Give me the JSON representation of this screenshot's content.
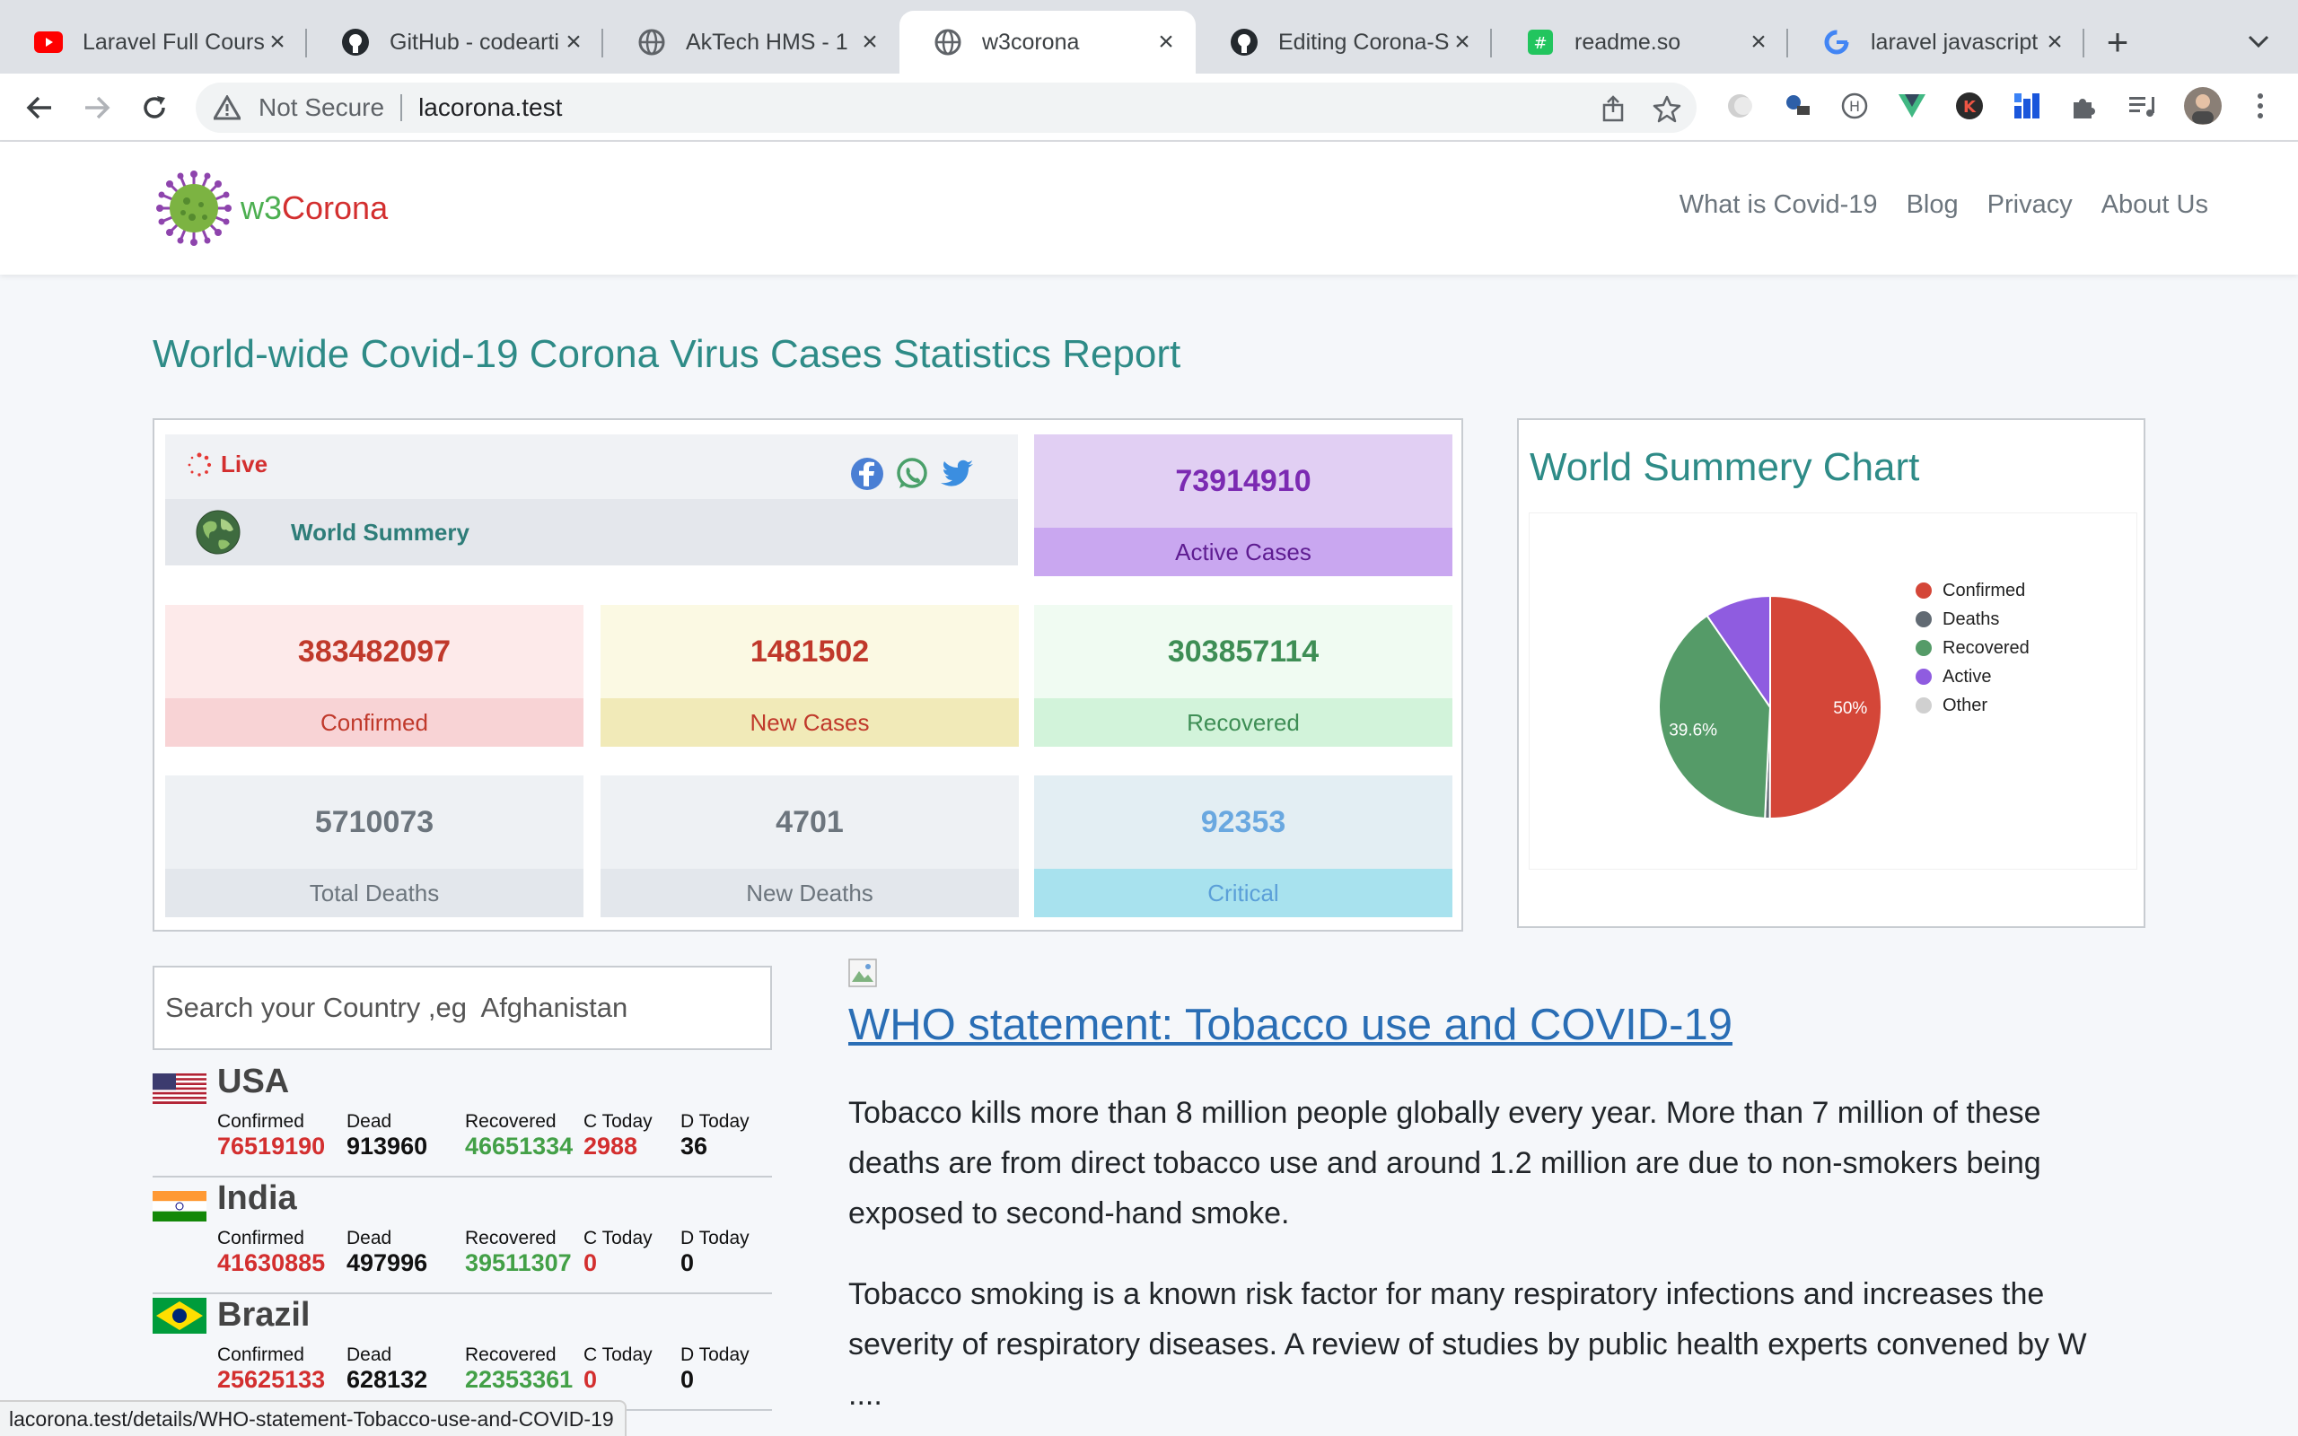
{
  "browser": {
    "tabs": [
      {
        "title": "Laravel Full Cours",
        "icon": "youtube-icon"
      },
      {
        "title": "GitHub - codearti",
        "icon": "github-icon"
      },
      {
        "title": "AkTech HMS - 1",
        "icon": "globe-icon"
      },
      {
        "title": "w3corona",
        "icon": "globe-icon",
        "active": true
      },
      {
        "title": "Editing Corona-St",
        "icon": "github-icon"
      },
      {
        "title": "readme.so",
        "icon": "readme-icon"
      },
      {
        "title": "laravel javascript",
        "icon": "google-icon"
      }
    ],
    "security_label": "Not Secure",
    "url": "lacorona.test",
    "status_url": "lacorona.test/details/WHO-statement-Tobacco-use-and-COVID-19"
  },
  "site": {
    "brand_w3": "w3",
    "brand_corona": "Corona",
    "nav": [
      "What is Covid-19",
      "Blog",
      "Privacy",
      "About Us"
    ]
  },
  "page": {
    "title": "World-wide Covid-19 Corona Virus Cases Statistics Report"
  },
  "summary": {
    "live_label": "Live",
    "world_label": "World Summery",
    "active": {
      "value": "73914910",
      "label": "Active Cases"
    },
    "confirmed": {
      "value": "383482097",
      "label": "Confirmed"
    },
    "new_cases": {
      "value": "1481502",
      "label": "New Cases"
    },
    "recovered": {
      "value": "303857114",
      "label": "Recovered"
    },
    "total_deaths": {
      "value": "5710073",
      "label": "Total Deaths"
    },
    "new_deaths": {
      "value": "4701",
      "label": "New Deaths"
    },
    "critical": {
      "value": "92353",
      "label": "Critical"
    }
  },
  "chart": {
    "title": "World Summery Chart"
  },
  "chart_data": {
    "type": "pie",
    "labels": [
      "Confirmed",
      "Deaths",
      "Recovered",
      "Active",
      "Other"
    ],
    "values": [
      50.0,
      0.7,
      39.6,
      9.6,
      0.0
    ],
    "slice_labels": [
      "50%",
      "",
      "39.6%",
      "",
      ""
    ],
    "colors": [
      "#d44638",
      "#616a73",
      "#559b68",
      "#8f5ce0",
      "#d0d0d0"
    ],
    "legend_position": "right"
  },
  "search": {
    "placeholder": "Search your Country ,eg  Afghanistan"
  },
  "countries": [
    {
      "name": "USA",
      "flag": "us",
      "confirmed_h": "Confirmed",
      "dead_h": "Dead",
      "recovered_h": "Recovered",
      "ctoday_h": "C Today",
      "dtoday_h": "D Today",
      "confirmed": "76519190",
      "dead": "913960",
      "recovered": "46651334",
      "ctoday": "2988",
      "dtoday": "36"
    },
    {
      "name": "India",
      "flag": "in",
      "confirmed_h": "Confirmed",
      "dead_h": "Dead",
      "recovered_h": "Recovered",
      "ctoday_h": "C Today",
      "dtoday_h": "D Today",
      "confirmed": "41630885",
      "dead": "497996",
      "recovered": "39511307",
      "ctoday": "0",
      "dtoday": "0"
    },
    {
      "name": "Brazil",
      "flag": "br",
      "confirmed_h": "Confirmed",
      "dead_h": "Dead",
      "recovered_h": "Recovered",
      "ctoday_h": "C Today",
      "dtoday_h": "D Today",
      "confirmed": "25625133",
      "dead": "628132",
      "recovered": "22353361",
      "ctoday": "0",
      "dtoday": "0"
    }
  ],
  "news": {
    "title": "WHO statement: Tobacco use and COVID-19",
    "para1": "Tobacco kills more than 8 million people globally every year. More than 7 million of these deaths are from direct tobacco use and around 1.2 million are due to non-smokers being exposed to second-hand smoke.",
    "para2": "Tobacco smoking is a known risk factor for many respiratory infections and increases the severity of respiratory diseases. A review of studies by public health experts convened by W ...."
  }
}
